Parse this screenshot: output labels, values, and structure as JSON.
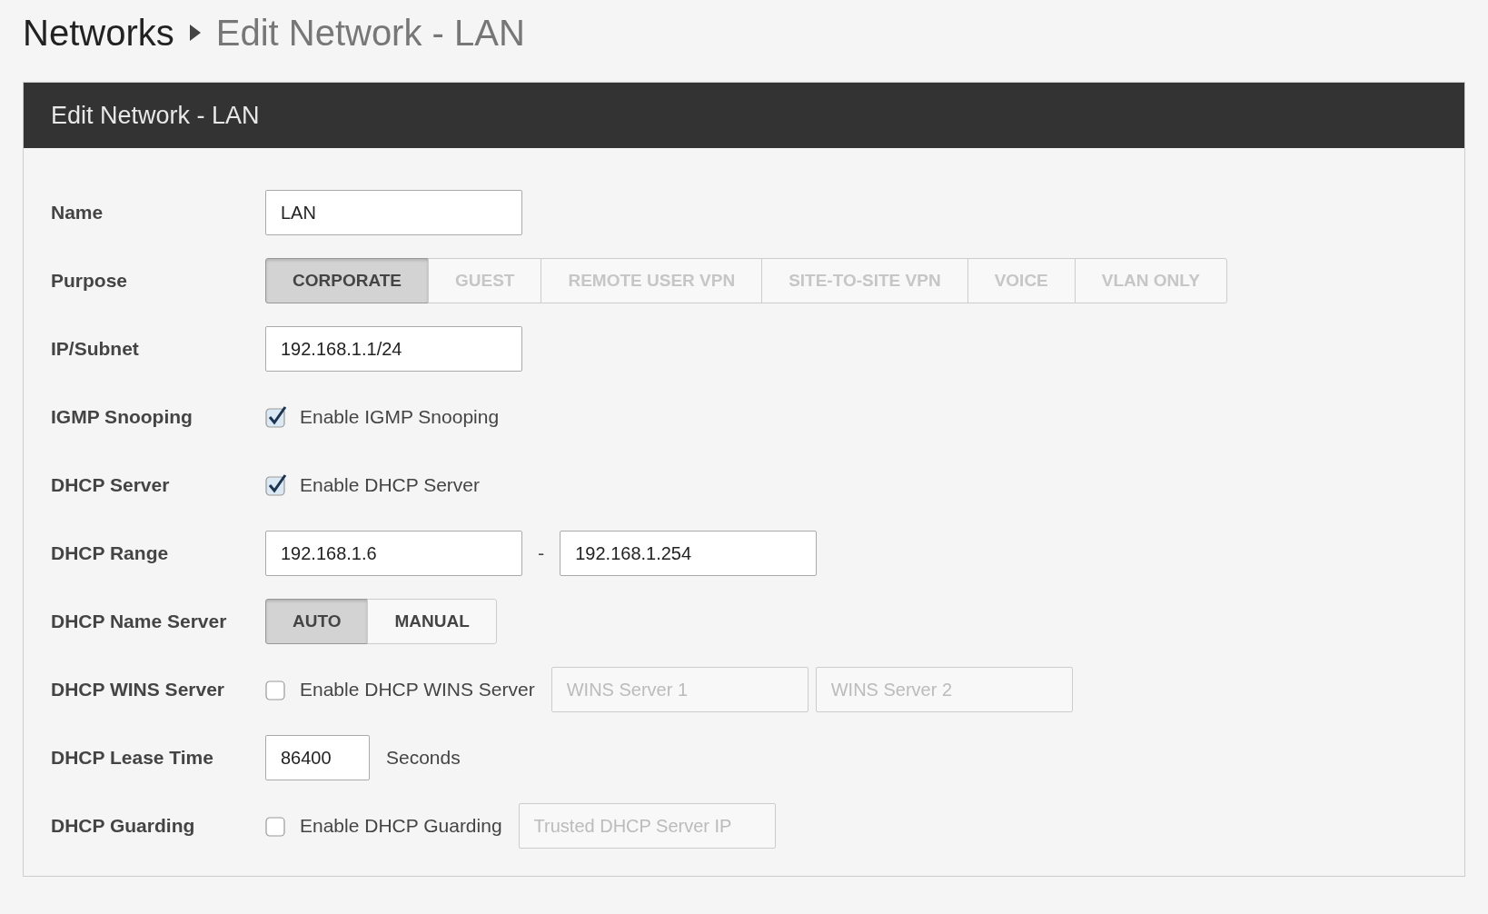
{
  "breadcrumb": {
    "parent": "Networks",
    "current": "Edit Network - LAN"
  },
  "panel": {
    "title": "Edit Network - LAN"
  },
  "fields": [
    {
      "label": "Name",
      "kind": "input",
      "value": "LAN"
    },
    {
      "label": "Purpose",
      "kind": "segmented",
      "options": [
        {
          "label": "CORPORATE",
          "selected": true,
          "disabled": false
        },
        {
          "label": "GUEST",
          "selected": false,
          "disabled": true
        },
        {
          "label": "REMOTE USER VPN",
          "selected": false,
          "disabled": true
        },
        {
          "label": "SITE-TO-SITE VPN",
          "selected": false,
          "disabled": true
        },
        {
          "label": "VOICE",
          "selected": false,
          "disabled": true
        },
        {
          "label": "VLAN ONLY",
          "selected": false,
          "disabled": true
        }
      ]
    },
    {
      "label": "IP/Subnet",
      "kind": "input",
      "value": "192.168.1.1/24"
    },
    {
      "label": "IGMP Snooping",
      "kind": "checkbox",
      "checkbox": {
        "label": "Enable IGMP Snooping",
        "checked": true
      }
    },
    {
      "label": "DHCP Server",
      "kind": "checkbox",
      "checkbox": {
        "label": "Enable DHCP Server",
        "checked": true
      }
    },
    {
      "label": "DHCP Range",
      "kind": "range",
      "from": "192.168.1.6",
      "separator": "-",
      "to": "192.168.1.254"
    },
    {
      "label": "DHCP Name Server",
      "kind": "segmented",
      "options": [
        {
          "label": "AUTO",
          "selected": true,
          "disabled": false
        },
        {
          "label": "MANUAL",
          "selected": false,
          "disabled": false
        }
      ]
    },
    {
      "label": "DHCP WINS Server",
      "kind": "checkbox",
      "checkbox": {
        "label": "Enable DHCP WINS Server",
        "checked": false
      },
      "inputs": [
        {
          "placeholder": "WINS Server 1"
        },
        {
          "placeholder": "WINS Server 2"
        }
      ]
    },
    {
      "label": "DHCP Lease Time",
      "kind": "number",
      "value": "86400",
      "unit": "Seconds"
    },
    {
      "label": "DHCP Guarding",
      "kind": "checkbox",
      "checkbox": {
        "label": "Enable DHCP Guarding",
        "checked": false
      },
      "inputs": [
        {
          "placeholder": "Trusted DHCP Server IP"
        }
      ]
    }
  ]
}
